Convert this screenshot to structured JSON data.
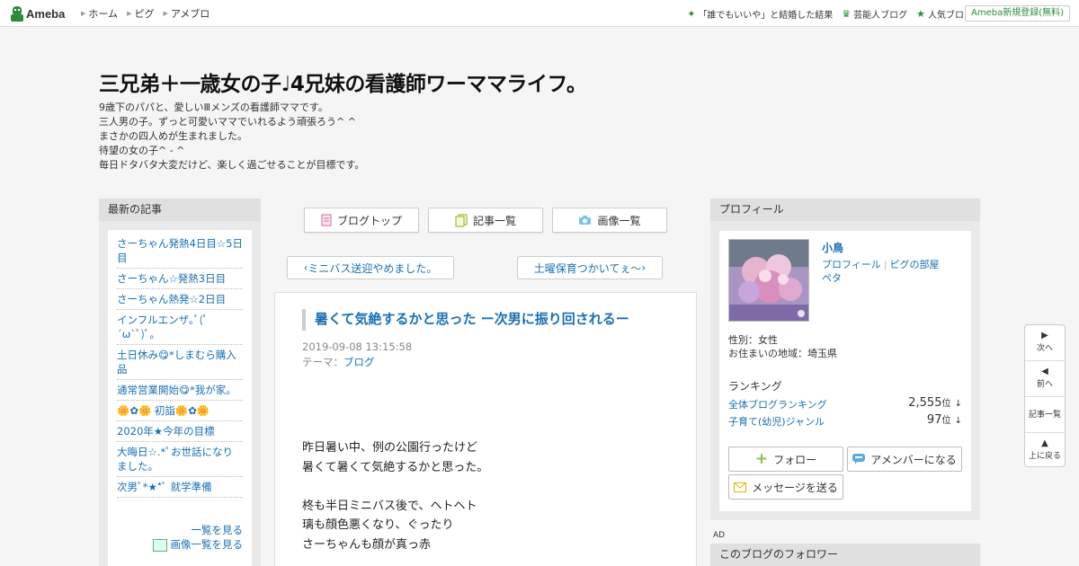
{
  "topbar": {
    "logo_text": "Ameba",
    "nav": [
      {
        "label": "ホーム"
      },
      {
        "label": "ピグ"
      },
      {
        "label": "アメブロ"
      }
    ],
    "links": [
      {
        "label": "「誰でもいいや」と結婚した結果",
        "icon": "sparkle-icon"
      },
      {
        "label": "芸能人ブログ",
        "icon": "crown-icon"
      },
      {
        "label": "人気ブログ",
        "icon": "star-icon"
      }
    ],
    "register": "Ameba新規登録(無料)"
  },
  "header": {
    "title": "三兄弟＋一歳女の子♩4兄妹の看護師ワーママライフ。",
    "description": [
      "9歳下のパパと、愛しいⅢメンズの看護師ママです。",
      "三人男の子。ずっと可愛いママでいれるよう頑張ろう^ ^",
      "まさかの四人めが生まれました。",
      "待望の女の子^ - ^",
      "毎日ドタバタ大変だけど、楽しく過ごせることが目標です。"
    ]
  },
  "sidebar_left": {
    "heading": "最新の記事",
    "items": [
      "さーちゃん発熱4日目☆5日目",
      "さーちゃん☆発熱3日目",
      "さーちゃん熱発☆2日目",
      "インフルエンザ｡ﾟ(ﾟ´ω`ﾟ)ﾟ｡",
      "土日休み😋*しまむら購入品",
      "通常営業開始😋*我が家。",
      "🌼✿🌼 初詣🌼✿🌼",
      "2020年★今年の目標",
      "大晦日☆.*ﾟお世話になりました。",
      "次男ﾟ*★*ﾟ 就学準備"
    ],
    "more": "一覧を見る",
    "more_images": "画像一覧を見る"
  },
  "center": {
    "tabs": [
      {
        "label": "ブログトップ",
        "icon": "document-icon"
      },
      {
        "label": "記事一覧",
        "icon": "list-icon"
      },
      {
        "label": "画像一覧",
        "icon": "camera-icon"
      }
    ],
    "prev_label": "ミニバス送迎やめました。",
    "next_label": "土曜保育つかいてぇ〜",
    "entry": {
      "title": "暑くて気絶するかと思った ー次男に振り回されるー",
      "date": "2019-09-08 13:15:58",
      "theme_label": "テーマ：",
      "theme": "ブログ",
      "body": [
        "昨日暑い中、例の公園行ったけど",
        "暑くて暑くて気絶するかと思った。",
        "",
        "柊も半日ミニバス後で、ヘトヘト",
        "璃も顔色悪くなり、ぐったり",
        "さーちゃんも顔が真っ赤"
      ]
    }
  },
  "sidebar_right": {
    "heading": "プロフィール",
    "name": "小鳥",
    "links": [
      "プロフィール",
      "ピグの部屋",
      "ペタ"
    ],
    "gender": "性別：女性",
    "region": "お住まいの地域：埼玉県",
    "ranking_heading": "ランキング",
    "rankings": [
      {
        "label": "全体ブログランキング",
        "value": "2,555",
        "unit": "位",
        "trend": "↓"
      },
      {
        "label": "子育て(幼児)ジャンル",
        "value": "97",
        "unit": "位",
        "trend": "↓"
      }
    ],
    "follow_label": "フォロー",
    "amember_label": "アメンバーになる",
    "message_label": "メッセージを送る",
    "ad_label": "AD",
    "followers_heading": "このブログのフォロワー"
  },
  "sidenav": {
    "next": "次へ",
    "prev": "前へ",
    "list": "記事一覧",
    "top": "上に戻る"
  },
  "colors": {
    "brand_green": "#2d8c3c",
    "link_blue": "#1a6fb5",
    "background": "#f5f5f5"
  }
}
